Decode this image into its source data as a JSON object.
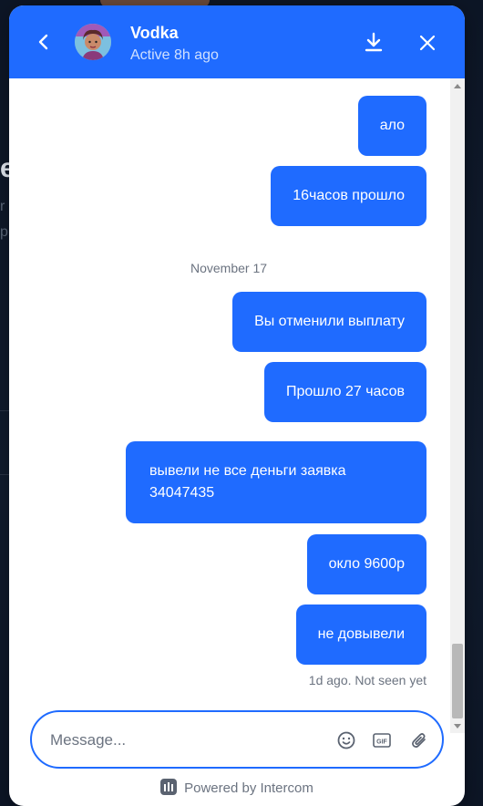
{
  "header": {
    "name": "Vodka",
    "status": "Active 8h ago"
  },
  "messages": [
    {
      "text": "ало"
    },
    {
      "text": "16часов прошло"
    },
    {
      "text": "Вы отменили выплату"
    },
    {
      "text": "Прошло 27 часов"
    },
    {
      "text": "вывели не все деньги заявка 34047435"
    },
    {
      "text": "окло 9600р"
    },
    {
      "text": "не довывели"
    }
  ],
  "date_separator": "November 17",
  "seen_status": "1d ago. Not seen yet",
  "composer": {
    "placeholder": "Message..."
  },
  "footer": {
    "powered_by": "Powered by Intercom"
  },
  "background_page": {
    "heading_fragment": "e",
    "line1": "r",
    "line2": "p"
  },
  "colors": {
    "accent": "#1f6bff",
    "bubble_text": "#ffffff",
    "meta_text": "#6b7380"
  },
  "icons": {
    "back": "chevron-left-icon",
    "download": "download-icon",
    "close": "close-icon",
    "emoji": "smiley-icon",
    "gif": "gif-icon",
    "attach": "paperclip-icon",
    "intercom": "intercom-logo-icon"
  }
}
